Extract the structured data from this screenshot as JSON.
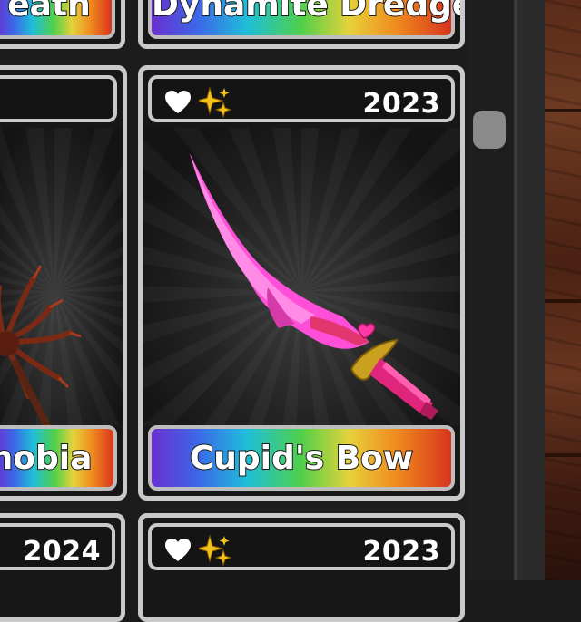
{
  "cards": {
    "top_left_name": "eath",
    "top_middle_name": "Dynamite Dredger",
    "left_name": "hobia",
    "left_year": "",
    "center": {
      "name": "Cupid's Bow",
      "year": "2023",
      "favorite_icon": "heart-icon",
      "tier_icon": "sparkle-icon"
    },
    "bottom_left_year": "2024",
    "bottom_middle_year": "2023"
  },
  "colors": {
    "frame": "#c9c9c9",
    "card_bg": "#171717",
    "sparkle": "#f2c21b",
    "blade_pink": "#ff4fd8",
    "guard_gold": "#c9a020"
  }
}
